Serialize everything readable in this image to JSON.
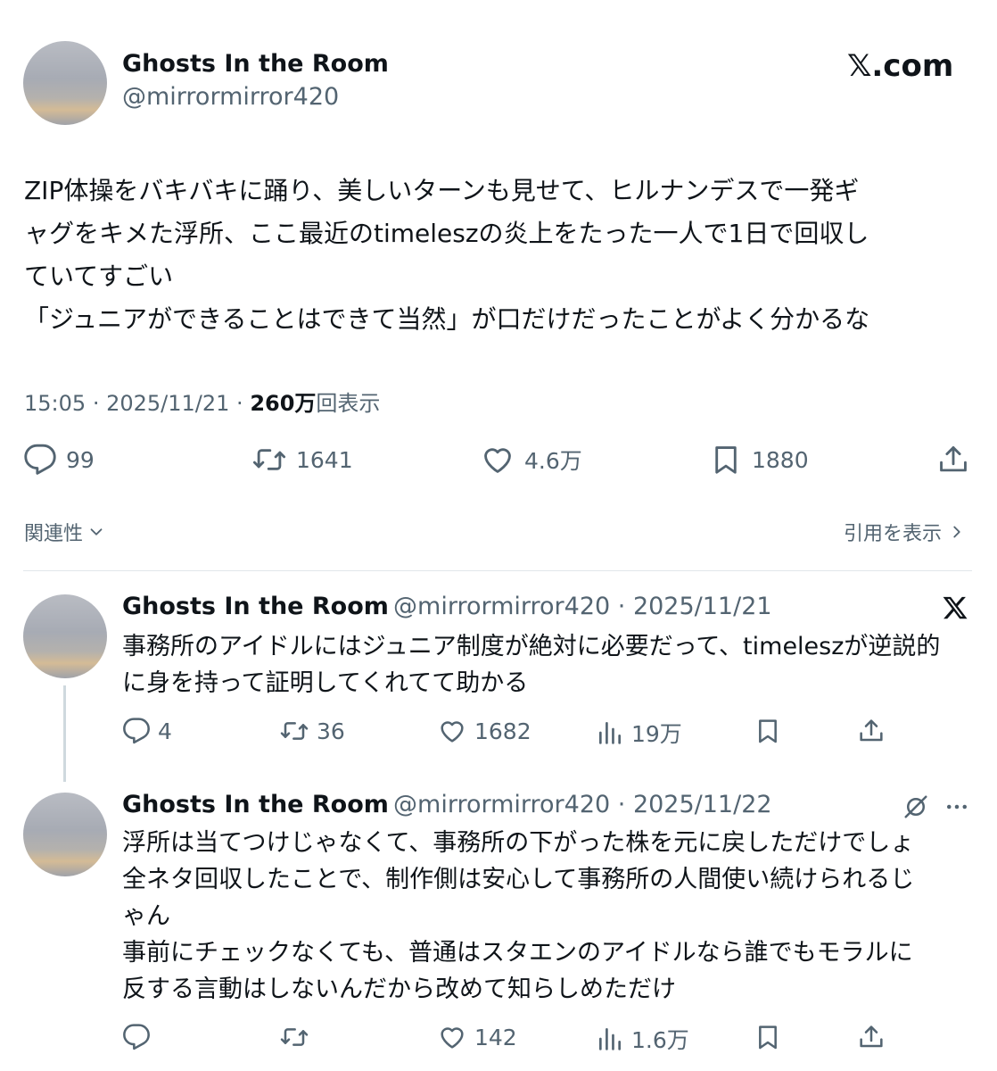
{
  "main_tweet": {
    "author_name": "Ghosts In the Room",
    "author_handle": "@mirrormirror420",
    "brand": "𝕏.com",
    "text_lines": [
      "ZIP体操をバキバキに踊り、美しいターンも見せて、ヒルナンデスで一発ギ",
      "ャグをキメた浮所、ここ最近のtimeleszの炎上をたった一人で1日で回収し",
      "ていてすごい",
      "「ジュニアができることはできて当然」が口だけだったことがよく分かるな"
    ],
    "time": "15:05",
    "date": "2025/11/21",
    "views_count": "260万",
    "views_label": "回表示",
    "actions": {
      "replies": "99",
      "retweets": "1641",
      "likes": "4.6万",
      "bookmarks": "1880"
    },
    "relevance_label": "関連性",
    "quotes_label": "引用を表示"
  },
  "replies": [
    {
      "author_name": "Ghosts In the Room",
      "author_handle": "@mirrormirror420",
      "date": "2025/11/21",
      "text_lines": [
        "事務所のアイドルにはジュニア制度が絶対に必要だって、timeleszが逆説的",
        "に身を持って証明してくれてて助かる"
      ],
      "actions": {
        "replies": "4",
        "retweets": "36",
        "likes": "1682",
        "views": "19万"
      }
    },
    {
      "author_name": "Ghosts In the Room",
      "author_handle": "@mirrormirror420",
      "date": "2025/11/22",
      "text_lines": [
        "浮所は当てつけじゃなくて、事務所の下がった株を元に戻しただけでしょ",
        "全ネタ回収したことで、制作側は安心して事務所の人間使い続けられるじ",
        "ゃん",
        "事前にチェックなくても、普通はスタエンのアイドルなら誰でもモラルに",
        "反する言動はしないんだから改めて知らしめただけ"
      ],
      "actions": {
        "replies": "",
        "retweets": "",
        "likes": "142",
        "views": "1.6万"
      }
    }
  ]
}
